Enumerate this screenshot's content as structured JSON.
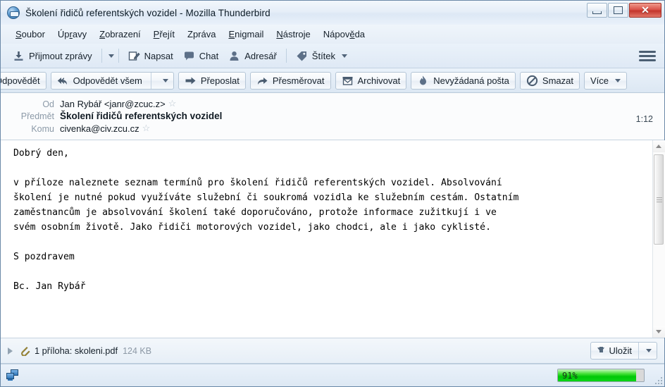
{
  "window": {
    "title": "Školení řidičů referentských vozidel - Mozilla Thunderbird",
    "app_icon": "thunderbird-icon",
    "controls": {
      "minimize": "minimize-icon",
      "restore": "restore-icon",
      "close": "close-icon"
    }
  },
  "menubar": {
    "items": [
      {
        "label": "Soubor",
        "accel": "S"
      },
      {
        "label": "Úpravy",
        "accel": "r"
      },
      {
        "label": "Zobrazení",
        "accel": "Z"
      },
      {
        "label": "Přejít",
        "accel": "P"
      },
      {
        "label": "Zpráva",
        "accel": ""
      },
      {
        "label": "Enigmail",
        "accel": "E"
      },
      {
        "label": "Nástroje",
        "accel": "N"
      },
      {
        "label": "Nápověda",
        "accel": "ě"
      }
    ]
  },
  "toolbar": {
    "get_messages": "Přijmout zprávy",
    "compose": "Napsat",
    "chat": "Chat",
    "addressbook": "Adresář",
    "tag": "Štítek",
    "app_menu": "app-menu-icon"
  },
  "message_toolbar": {
    "reply": "Odpovědět",
    "reply_clipped": "dpovědět",
    "reply_all": "Odpovědět všem",
    "forward": "Přeposlat",
    "redirect": "Přesměrovat",
    "archive": "Archivovat",
    "junk": "Nevyžádaná pošta",
    "delete": "Smazat",
    "more": "Více"
  },
  "message_header": {
    "from_label": "Od",
    "from_value": "Jan Rybář <janr@zcuc.z>",
    "subject_label": "Předmět",
    "subject_value": "Školení řidičů referentských vozidel",
    "to_label": "Komu",
    "to_value": "civenka@civ.zcu.cz",
    "time": "1:12",
    "star_icon": "star-icon"
  },
  "message_body": {
    "text": "Dobrý den,\n\nv příloze naleznete seznam termínů pro školení řidičů referentských vozidel. Absolvování\nškolení je nutné pokud využíváte služební či soukromá vozidla ke služebním cestám. Ostatním\nzaměstnancům je absolvování školení také doporučováno, protože informace zužitkují i ve\nsvém osobním životě. Jako řidiči motorových vozidel, jako chodci, ale i jako cyklisté.\n\nS pozdravem\n\nBc. Jan Rybář"
  },
  "attachment": {
    "expand_icon": "expand-triangle-icon",
    "clip_icon": "paperclip-icon",
    "text": "1 příloha: skoleni.pdf",
    "size": "124 KB",
    "save_label": "Uložit",
    "save_icon": "download-arrow-icon"
  },
  "statusbar": {
    "network_icon": "network-computers-icon",
    "progress_percent": "91%",
    "progress_value": 91,
    "progress_color": "#00c806"
  }
}
